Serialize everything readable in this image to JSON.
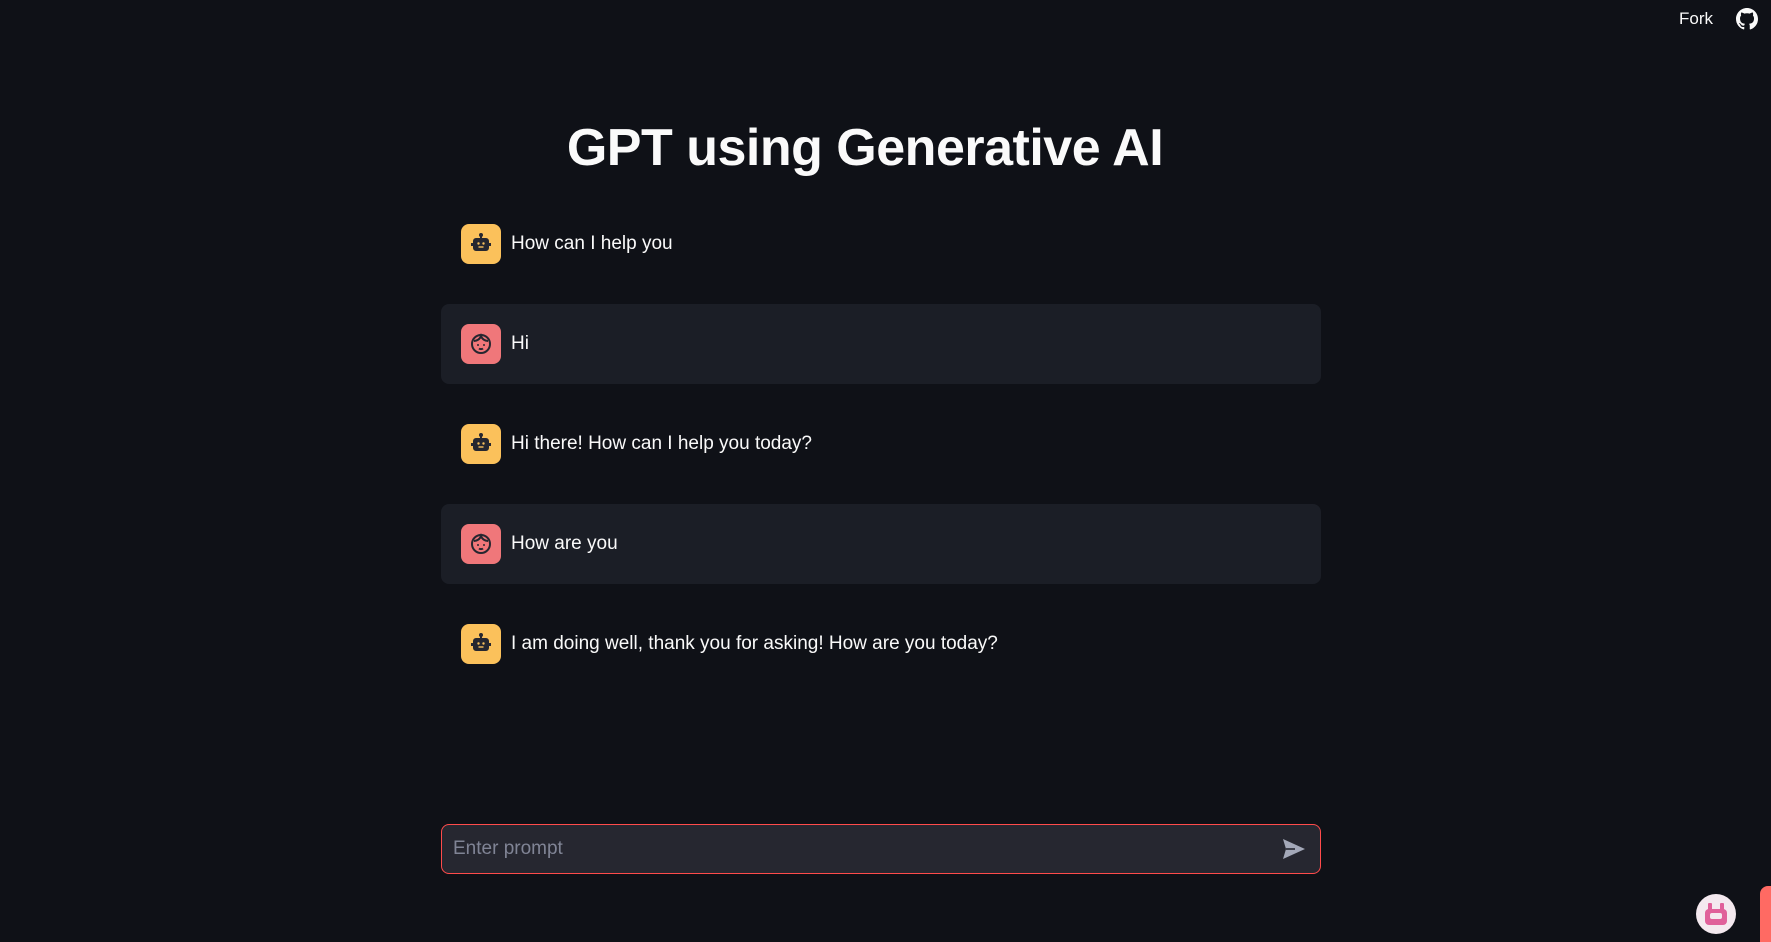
{
  "header": {
    "fork_label": "Fork",
    "github_icon": "github-icon"
  },
  "main": {
    "title": "GPT using Generative AI"
  },
  "messages": [
    {
      "role": "assistant",
      "icon": "robot-icon",
      "text": "How can I help you"
    },
    {
      "role": "user",
      "icon": "face-icon",
      "text": "Hi"
    },
    {
      "role": "assistant",
      "icon": "robot-icon",
      "text": "Hi there! How can I help you today?"
    },
    {
      "role": "user",
      "icon": "face-icon",
      "text": "How are you"
    },
    {
      "role": "assistant",
      "icon": "robot-icon",
      "text": "I am doing well, thank you for asking! How are you today?"
    }
  ],
  "prompt": {
    "placeholder": "Enter prompt",
    "value": "",
    "send_icon": "send-icon"
  },
  "colors": {
    "background": "#0f1117",
    "user_bubble": "#1b1e26",
    "bot_avatar": "#fbc15b",
    "user_avatar": "#f0777a",
    "accent": "#ff4b4b"
  }
}
